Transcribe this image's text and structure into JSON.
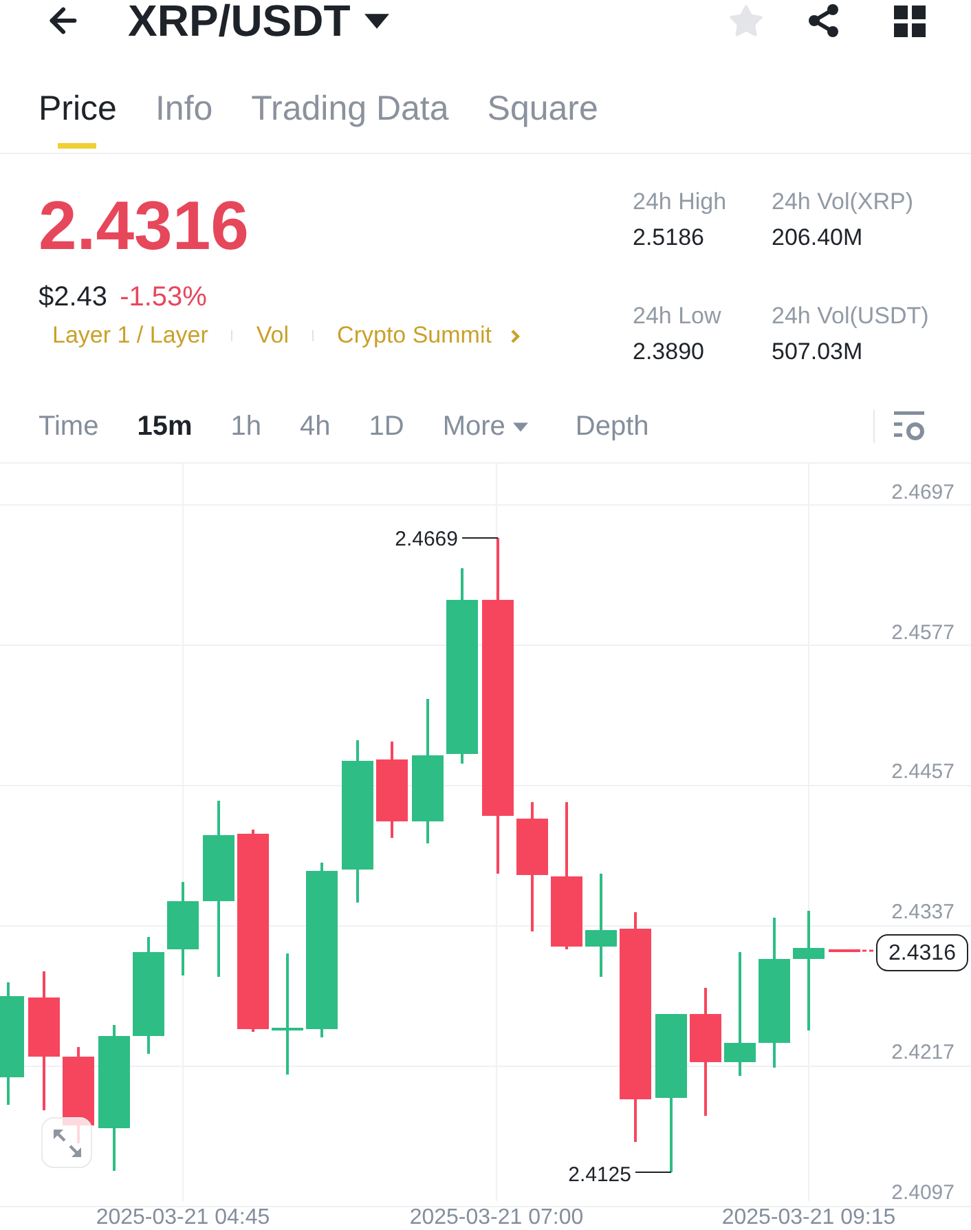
{
  "header": {
    "title": "XRP/USDT",
    "favorite": false
  },
  "tabs": [
    {
      "label": "Price",
      "selected": true
    },
    {
      "label": "Info",
      "selected": false
    },
    {
      "label": "Trading Data",
      "selected": false
    },
    {
      "label": "Square",
      "selected": false
    }
  ],
  "ticker": {
    "last_price": "2.4316",
    "falling": true,
    "usd_price": "$2.43",
    "change": "-1.53%",
    "tags": [
      {
        "label": "Layer 1 / Layer",
        "kind": "tag"
      },
      {
        "label": "Vol",
        "kind": "tag"
      },
      {
        "label": "Crypto Summit",
        "kind": "link"
      }
    ]
  },
  "stats": [
    {
      "label": "24h High",
      "value": "2.5186"
    },
    {
      "label": "24h Vol(XRP)",
      "value": "206.40M"
    },
    {
      "label": "24h Low",
      "value": "2.3890"
    },
    {
      "label": "24h Vol(USDT)",
      "value": "507.03M"
    }
  ],
  "intervals": [
    {
      "label": "Time",
      "kind": "interval",
      "selected": false
    },
    {
      "label": "15m",
      "kind": "interval",
      "selected": true
    },
    {
      "label": "1h",
      "kind": "interval",
      "selected": false
    },
    {
      "label": "4h",
      "kind": "interval",
      "selected": false
    },
    {
      "label": "1D",
      "kind": "interval",
      "selected": false
    },
    {
      "label": "More",
      "kind": "dropdown",
      "selected": false
    },
    {
      "label": "Depth",
      "kind": "view",
      "selected": false
    }
  ],
  "chart": {
    "y_axis": [
      "2.4697",
      "2.4577",
      "2.4457",
      "2.4337",
      "2.4217",
      "2.4097"
    ],
    "high_label": "2.4669",
    "low_label": "2.4125",
    "last_price_tag": "2.4316",
    "x_axis": [
      "2025-03-21 04:45",
      "2025-03-21 07:00",
      "2025-03-21 09:15"
    ]
  }
}
